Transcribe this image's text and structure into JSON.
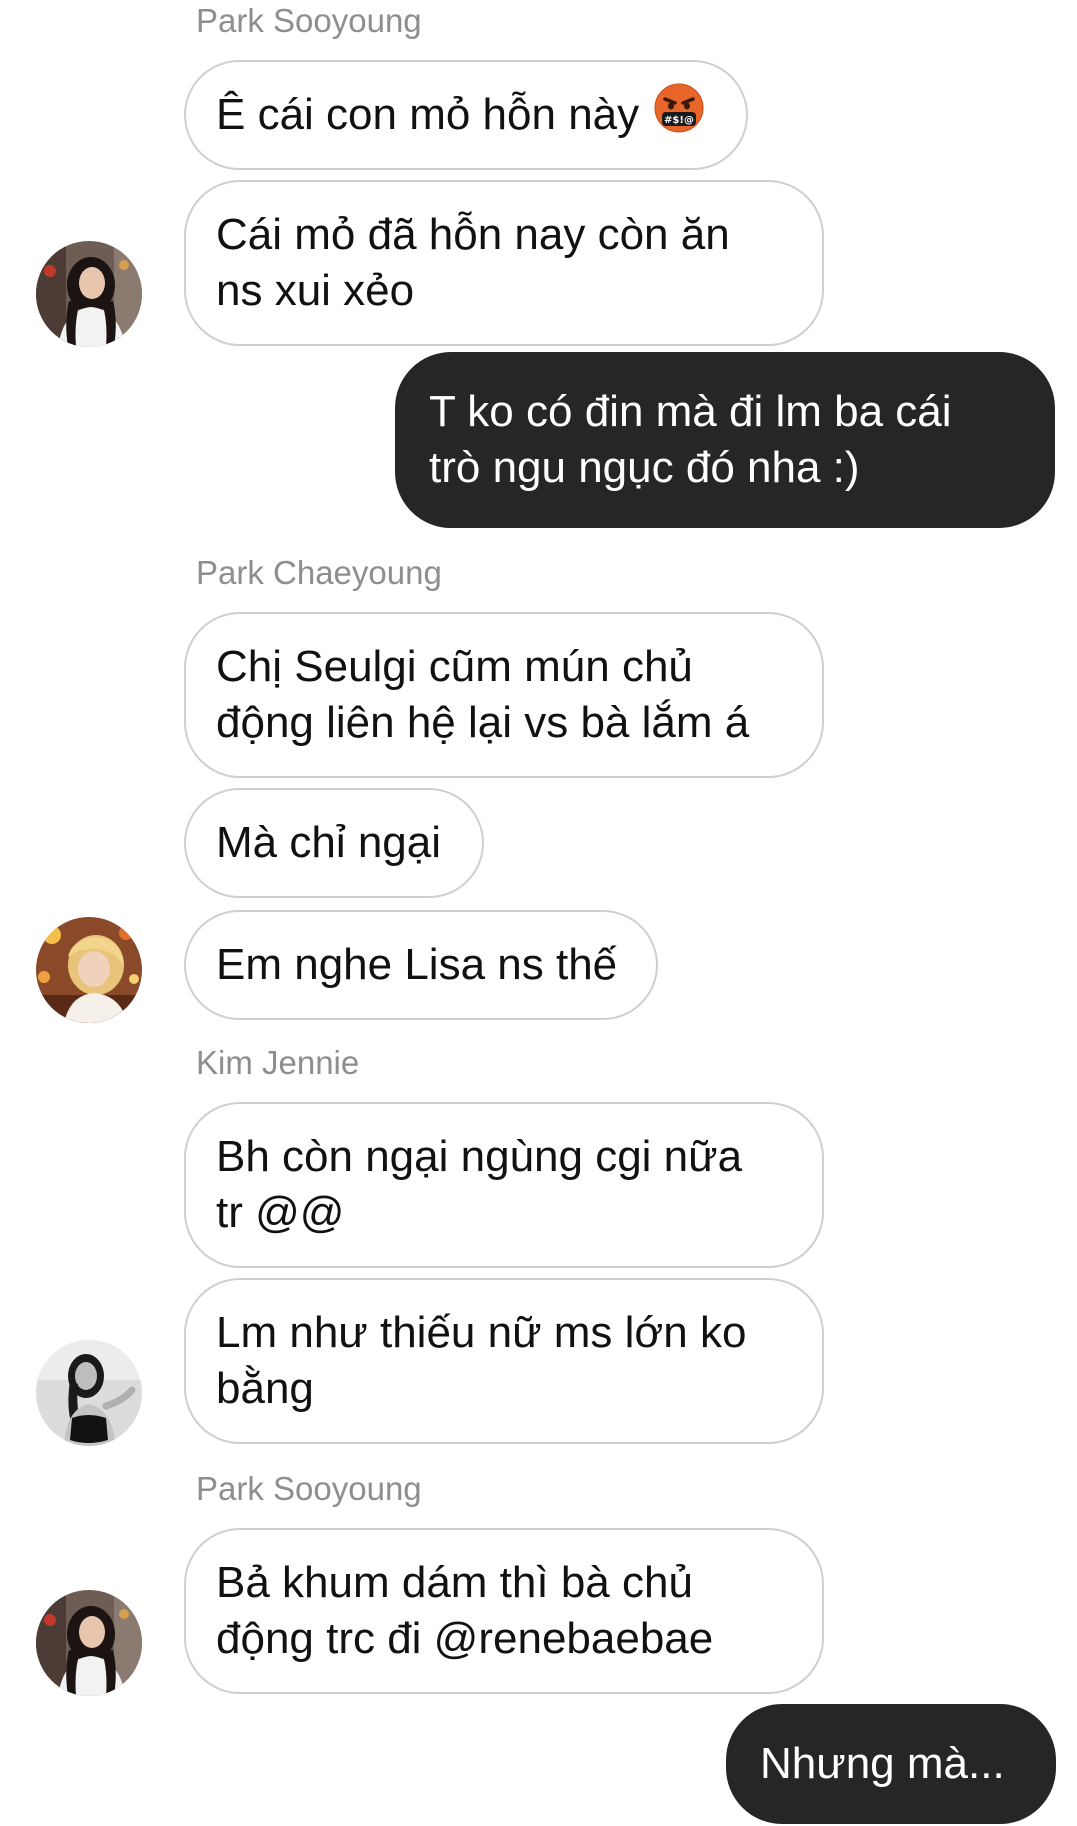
{
  "messages": {
    "g1": {
      "sender": "Park Sooyoung",
      "m1": "Ê cái con mỏ hỗn này",
      "m1_emoji": "face-with-symbols-on-mouth-icon",
      "m2": "Cái mỏ đã hỗn nay còn ăn\nns xui xẻo"
    },
    "me1": "T ko có đin mà đi lm ba cái\ntrò ngu ngục đó nha :)",
    "g2": {
      "sender": "Park Chaeyoung",
      "m1": "Chị Seulgi cũm mún chủ\nđộng liên hệ lại vs bà lắm á",
      "m2": "Mà chỉ ngại",
      "m3": "Em nghe Lisa ns thế"
    },
    "g3": {
      "sender": "Kim Jennie",
      "m1": "Bh còn ngại ngùng cgi nữa\ntr @@",
      "m2": "Lm như thiếu nữ ms lớn ko\nbằng"
    },
    "g4": {
      "sender": "Park Sooyoung",
      "m1": "Bả khum dám thì bà chủ\nđộng trc đi @renebaebae"
    },
    "me2": "Nhưng mà..."
  },
  "colors": {
    "background": "#ffffff",
    "incoming_bubble_border": "#cfcfcf",
    "outgoing_bubble": "#262626",
    "sender_name": "#8e8e8e"
  }
}
